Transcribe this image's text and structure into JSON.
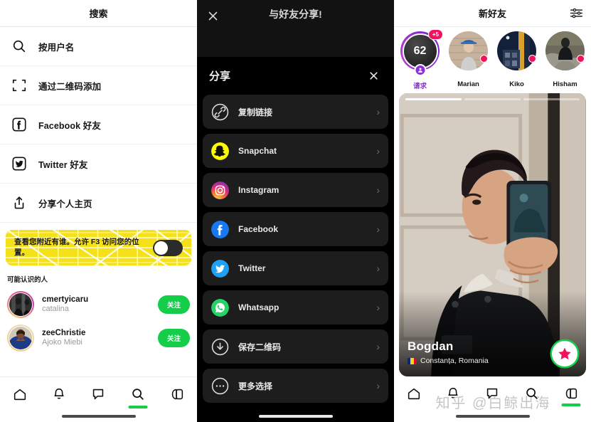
{
  "colors": {
    "accent_green": "#14CE4A",
    "banner_yellow": "#F5E11A",
    "badge_pink": "#F2115C",
    "purple": "#8B2FD6",
    "dark_sheet": "#000000",
    "dark_item": "#1D1D1D"
  },
  "search_panel": {
    "header_title": "搜索",
    "rows": [
      {
        "icon": "search-icon",
        "label": "按用户名"
      },
      {
        "icon": "qrcode-scan-icon",
        "label": "通过二维码添加"
      },
      {
        "icon": "facebook-icon",
        "label": "Facebook 好友"
      },
      {
        "icon": "twitter-icon",
        "label": "Twitter 好友"
      },
      {
        "icon": "share-icon",
        "label": "分享个人主页"
      }
    ],
    "banner": {
      "text": "查看您附近有谁。允许 F3 访问您的位置。",
      "toggle_state": "off"
    },
    "section_title": "可能认识的人",
    "people": [
      {
        "name": "cmertyicaru",
        "sub": "catalina",
        "action": "关注"
      },
      {
        "name": "zeeChristie",
        "sub": "Ajoko Miebi",
        "action": "关注"
      }
    ],
    "tabs": [
      {
        "icon": "home-icon",
        "active": false
      },
      {
        "icon": "bell-icon",
        "active": false
      },
      {
        "icon": "chat-bubble-icon",
        "active": false
      },
      {
        "icon": "search-icon",
        "active": true
      },
      {
        "icon": "cards-icon",
        "active": false
      }
    ]
  },
  "share_panel": {
    "top_title": "与好友分享!",
    "close_label": "×",
    "sheet_title": "分享",
    "items": [
      {
        "icon": "link-icon",
        "label": "复制链接"
      },
      {
        "icon": "snapchat-icon",
        "label": "Snapchat"
      },
      {
        "icon": "instagram-icon",
        "label": "Instagram"
      },
      {
        "icon": "facebook-icon",
        "label": "Facebook"
      },
      {
        "icon": "twitter-icon",
        "label": "Twitter"
      },
      {
        "icon": "whatsapp-icon",
        "label": "Whatsapp"
      },
      {
        "icon": "download-icon",
        "label": "保存二维码"
      },
      {
        "icon": "ellipsis-icon",
        "label": "更多选择"
      }
    ],
    "chevron": "›"
  },
  "friends_panel": {
    "header_title": "新好友",
    "filter_icon": "sliders-icon",
    "requests": {
      "count": "62",
      "plus_badge": "+5",
      "label": "请求"
    },
    "stories": [
      {
        "name": "Marian",
        "has_dot": true
      },
      {
        "name": "Kiko",
        "has_dot": true
      },
      {
        "name": "Hisham",
        "has_dot": true
      },
      {
        "name": "",
        "has_dot": true
      }
    ],
    "card": {
      "name": "Bogdan",
      "location": "Constanța, Romania",
      "flag": "romania-flag",
      "star_button": "star-icon",
      "progress_segments": 3,
      "progress_active": 1
    },
    "tabs": [
      {
        "icon": "home-icon",
        "active": false
      },
      {
        "icon": "bell-icon",
        "active": false
      },
      {
        "icon": "chat-bubble-icon",
        "active": false
      },
      {
        "icon": "search-icon",
        "active": false
      },
      {
        "icon": "cards-icon",
        "active": true
      }
    ]
  },
  "watermark": {
    "text": "知乎 @白鲸出海"
  }
}
